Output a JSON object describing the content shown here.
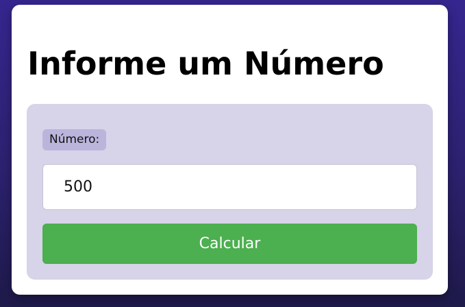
{
  "card": {
    "title": "Informe um Número"
  },
  "form": {
    "number_label": "Número:",
    "number_value": "500",
    "submit_label": "Calcular"
  },
  "colors": {
    "background": "#2f237a",
    "card": "#ffffff",
    "panel": "#d7d3e9",
    "label_chip": "#bbb5dc",
    "button": "#4caf50",
    "button_text": "#ffffff"
  }
}
